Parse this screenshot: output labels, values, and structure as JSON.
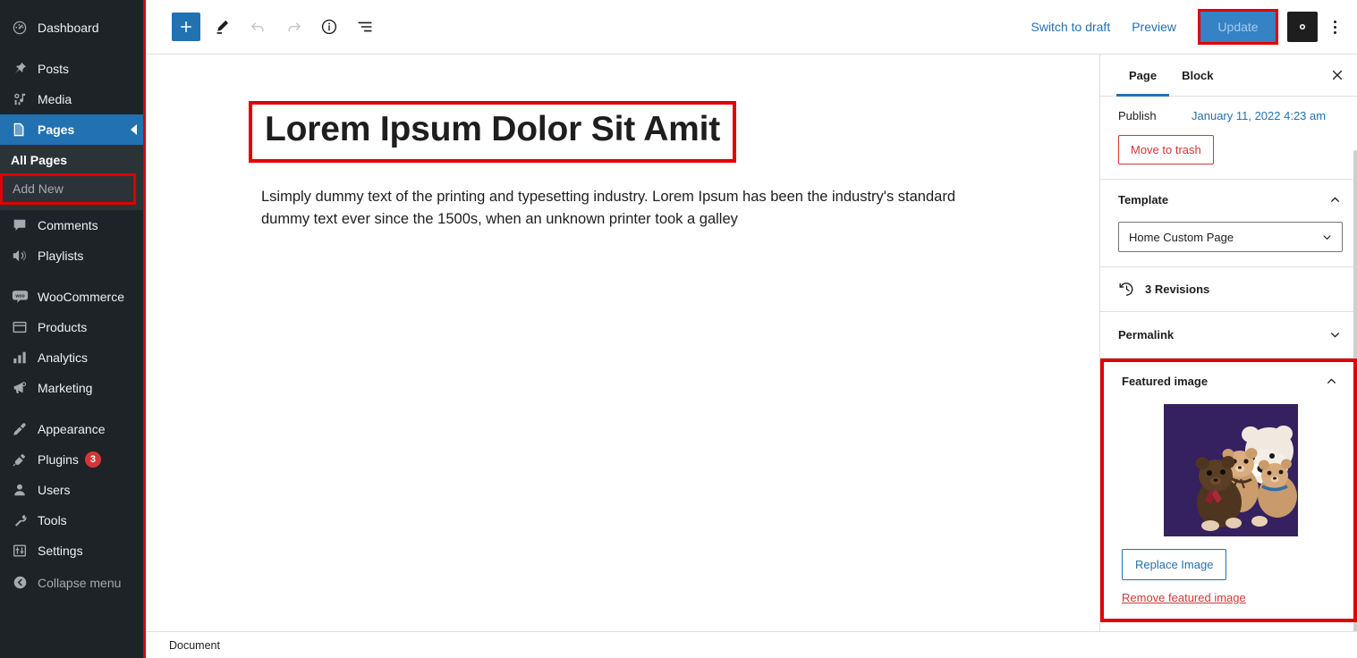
{
  "sidebar": {
    "items": [
      {
        "label": "Dashboard",
        "icon": "dashboard-icon",
        "name": "dashboard"
      },
      {
        "label": "Posts",
        "icon": "pin-icon",
        "name": "posts"
      },
      {
        "label": "Media",
        "icon": "media-icon",
        "name": "media"
      },
      {
        "label": "Pages",
        "icon": "pages-icon",
        "name": "pages",
        "current": true
      },
      {
        "label": "Comments",
        "icon": "comment-icon",
        "name": "comments"
      },
      {
        "label": "Playlists",
        "icon": "speaker-icon",
        "name": "playlists"
      },
      {
        "label": "WooCommerce",
        "icon": "woocommerce-icon",
        "name": "woocommerce"
      },
      {
        "label": "Products",
        "icon": "products-icon",
        "name": "products"
      },
      {
        "label": "Analytics",
        "icon": "chart-icon",
        "name": "analytics"
      },
      {
        "label": "Marketing",
        "icon": "megaphone-icon",
        "name": "marketing"
      },
      {
        "label": "Appearance",
        "icon": "paintbrush-icon",
        "name": "appearance"
      },
      {
        "label": "Plugins",
        "icon": "plug-icon",
        "name": "plugins",
        "badge": "3"
      },
      {
        "label": "Users",
        "icon": "user-icon",
        "name": "users"
      },
      {
        "label": "Tools",
        "icon": "wrench-icon",
        "name": "tools"
      },
      {
        "label": "Settings",
        "icon": "sliders-icon",
        "name": "settings"
      },
      {
        "label": "Collapse menu",
        "icon": "collapse-icon",
        "name": "collapse-menu"
      }
    ],
    "submenu": {
      "all_pages": "All Pages",
      "add_new": "Add New"
    }
  },
  "toolbar": {
    "add_block": "+",
    "tools_title": "Tools",
    "undo_title": "Undo",
    "redo_title": "Redo",
    "details_title": "Details",
    "list_view_title": "List View",
    "switch_to_draft": "Switch to draft",
    "preview": "Preview",
    "update": "Update",
    "settings_title": "Settings",
    "options_title": "Options"
  },
  "canvas": {
    "title": "Lorem Ipsum Dolor Sit Amit",
    "paragraph": "Lsimply dummy text of the printing and typesetting industry. Lorem Ipsum has been the industry's standard dummy text ever since the 1500s, when an unknown printer took a galley"
  },
  "inspector": {
    "tabs": [
      {
        "label": "Page",
        "active": true
      },
      {
        "label": "Block",
        "active": false
      }
    ],
    "close_label": "Close settings",
    "publish": {
      "label": "Publish",
      "date": "January 11, 2022 4:23 am",
      "trash": "Move to trash"
    },
    "template": {
      "title": "Template",
      "selected": "Home Custom Page"
    },
    "revisions": {
      "label": "3 Revisions"
    },
    "permalink": {
      "title": "Permalink"
    },
    "featured_image": {
      "title": "Featured image",
      "replace": "Replace Image",
      "remove": "Remove featured image",
      "image_alt": "teddy bears on purple background"
    }
  },
  "footer": {
    "breadcrumb": "Document"
  },
  "colors": {
    "admin_bg": "#1d2327",
    "submenu_bg": "#2c3338",
    "accent_blue": "#2271b1",
    "update_blue": "#3582c4",
    "danger_red": "#d63638",
    "highlight_red": "#e00000",
    "featured_bg": "#352060"
  }
}
